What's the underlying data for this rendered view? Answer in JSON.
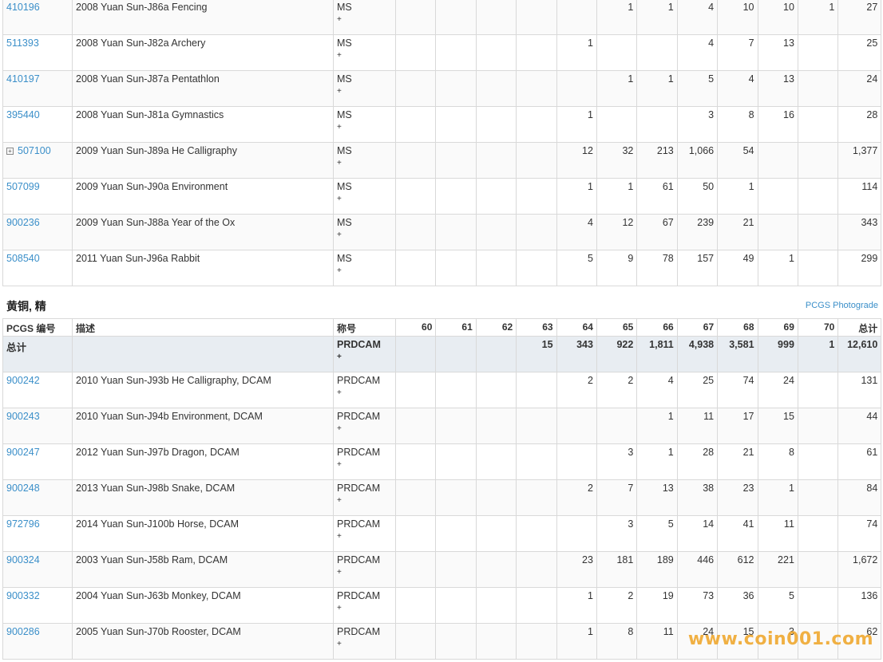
{
  "top_rows": [
    {
      "code": "410196",
      "desc": "2008 Yuan Sun-J86a Fencing",
      "des": "MS",
      "plus": "+",
      "g": [
        "",
        "",
        "",
        "",
        "",
        "1",
        "1",
        "4",
        "10",
        "10",
        "1"
      ],
      "total": "27"
    },
    {
      "code": "511393",
      "desc": "2008 Yuan Sun-J82a Archery",
      "des": "MS",
      "plus": "+",
      "g": [
        "",
        "",
        "",
        "",
        "1",
        "",
        "",
        "4",
        "7",
        "13",
        ""
      ],
      "total": "25"
    },
    {
      "code": "410197",
      "desc": "2008 Yuan Sun-J87a Pentathlon",
      "des": "MS",
      "plus": "+",
      "g": [
        "",
        "",
        "",
        "",
        "",
        "1",
        "1",
        "5",
        "4",
        "13",
        ""
      ],
      "total": "24"
    },
    {
      "code": "395440",
      "desc": "2008 Yuan Sun-J81a Gymnastics",
      "des": "MS",
      "plus": "+",
      "g": [
        "",
        "",
        "",
        "",
        "1",
        "",
        "",
        "3",
        "8",
        "16",
        ""
      ],
      "total": "28"
    },
    {
      "code": "507100",
      "expand": "+",
      "desc": "2009 Yuan Sun-J89a He Calligraphy",
      "des": "MS",
      "plus": "+",
      "g": [
        "",
        "",
        "",
        "",
        "12",
        "32",
        "213",
        "1,066",
        "54",
        "",
        ""
      ],
      "total": "1,377"
    },
    {
      "code": "507099",
      "desc": "2009 Yuan Sun-J90a Environment",
      "des": "MS",
      "plus": "+",
      "g": [
        "",
        "",
        "",
        "",
        "1",
        "1",
        "61",
        "50",
        "1",
        "",
        ""
      ],
      "total": "114"
    },
    {
      "code": "900236",
      "desc": "2009 Yuan Sun-J88a Year of the Ox",
      "des": "MS",
      "plus": "+",
      "g": [
        "",
        "",
        "",
        "",
        "4",
        "12",
        "67",
        "239",
        "21",
        "",
        ""
      ],
      "total": "343"
    },
    {
      "code": "508540",
      "desc": "2011 Yuan Sun-J96a Rabbit",
      "des": "MS",
      "plus": "+",
      "g": [
        "",
        "",
        "",
        "",
        "5",
        "9",
        "78",
        "157",
        "49",
        "1",
        ""
      ],
      "total": "299"
    }
  ],
  "section": {
    "title": "黄铜, 精",
    "photograde": "PCGS Photograde"
  },
  "headers": {
    "code": "PCGS 编号",
    "desc": "描述",
    "des": "称号",
    "grades": [
      "60",
      "61",
      "62",
      "63",
      "64",
      "65",
      "66",
      "67",
      "68",
      "69",
      "70"
    ],
    "total": "总计"
  },
  "total_row": {
    "label": "总计",
    "des": "PRDCAM",
    "plus": "+",
    "g": [
      "",
      "",
      "",
      "15",
      "343",
      "922",
      "1,811",
      "4,938",
      "3,581",
      "999",
      "1"
    ],
    "total": "12,610"
  },
  "bottom_rows": [
    {
      "code": "900242",
      "desc": "2010 Yuan Sun-J93b He Calligraphy, DCAM",
      "des": "PRDCAM",
      "plus": "+",
      "g": [
        "",
        "",
        "",
        "",
        "2",
        "2",
        "4",
        "25",
        "74",
        "24",
        ""
      ],
      "total": "131"
    },
    {
      "code": "900243",
      "desc": "2010 Yuan Sun-J94b Environment, DCAM",
      "des": "PRDCAM",
      "plus": "+",
      "g": [
        "",
        "",
        "",
        "",
        "",
        "",
        "1",
        "11",
        "17",
        "15",
        ""
      ],
      "total": "44"
    },
    {
      "code": "900247",
      "desc": "2012 Yuan Sun-J97b Dragon, DCAM",
      "des": "PRDCAM",
      "plus": "+",
      "g": [
        "",
        "",
        "",
        "",
        "",
        "3",
        "1",
        "28",
        "21",
        "8",
        ""
      ],
      "total": "61"
    },
    {
      "code": "900248",
      "desc": "2013 Yuan Sun-J98b Snake, DCAM",
      "des": "PRDCAM",
      "plus": "+",
      "g": [
        "",
        "",
        "",
        "",
        "2",
        "7",
        "13",
        "38",
        "23",
        "1",
        ""
      ],
      "total": "84"
    },
    {
      "code": "972796",
      "desc": "2014 Yuan Sun-J100b Horse, DCAM",
      "des": "PRDCAM",
      "plus": "+",
      "g": [
        "",
        "",
        "",
        "",
        "",
        "3",
        "5",
        "14",
        "41",
        "11",
        ""
      ],
      "total": "74"
    },
    {
      "code": "900324",
      "desc": "2003 Yuan Sun-J58b Ram, DCAM",
      "des": "PRDCAM",
      "plus": "+",
      "g": [
        "",
        "",
        "",
        "",
        "23",
        "181",
        "189",
        "446",
        "612",
        "221",
        ""
      ],
      "total": "1,672"
    },
    {
      "code": "900332",
      "desc": "2004 Yuan Sun-J63b Monkey, DCAM",
      "des": "PRDCAM",
      "plus": "+",
      "g": [
        "",
        "",
        "",
        "",
        "1",
        "2",
        "19",
        "73",
        "36",
        "5",
        ""
      ],
      "total": "136"
    },
    {
      "code": "900286",
      "desc": "2005 Yuan Sun-J70b Rooster, DCAM",
      "des": "PRDCAM",
      "plus": "+",
      "g": [
        "",
        "",
        "",
        "",
        "1",
        "8",
        "11",
        "24",
        "15",
        "3",
        ""
      ],
      "total": "62"
    }
  ],
  "watermark": "www.coin001.com"
}
